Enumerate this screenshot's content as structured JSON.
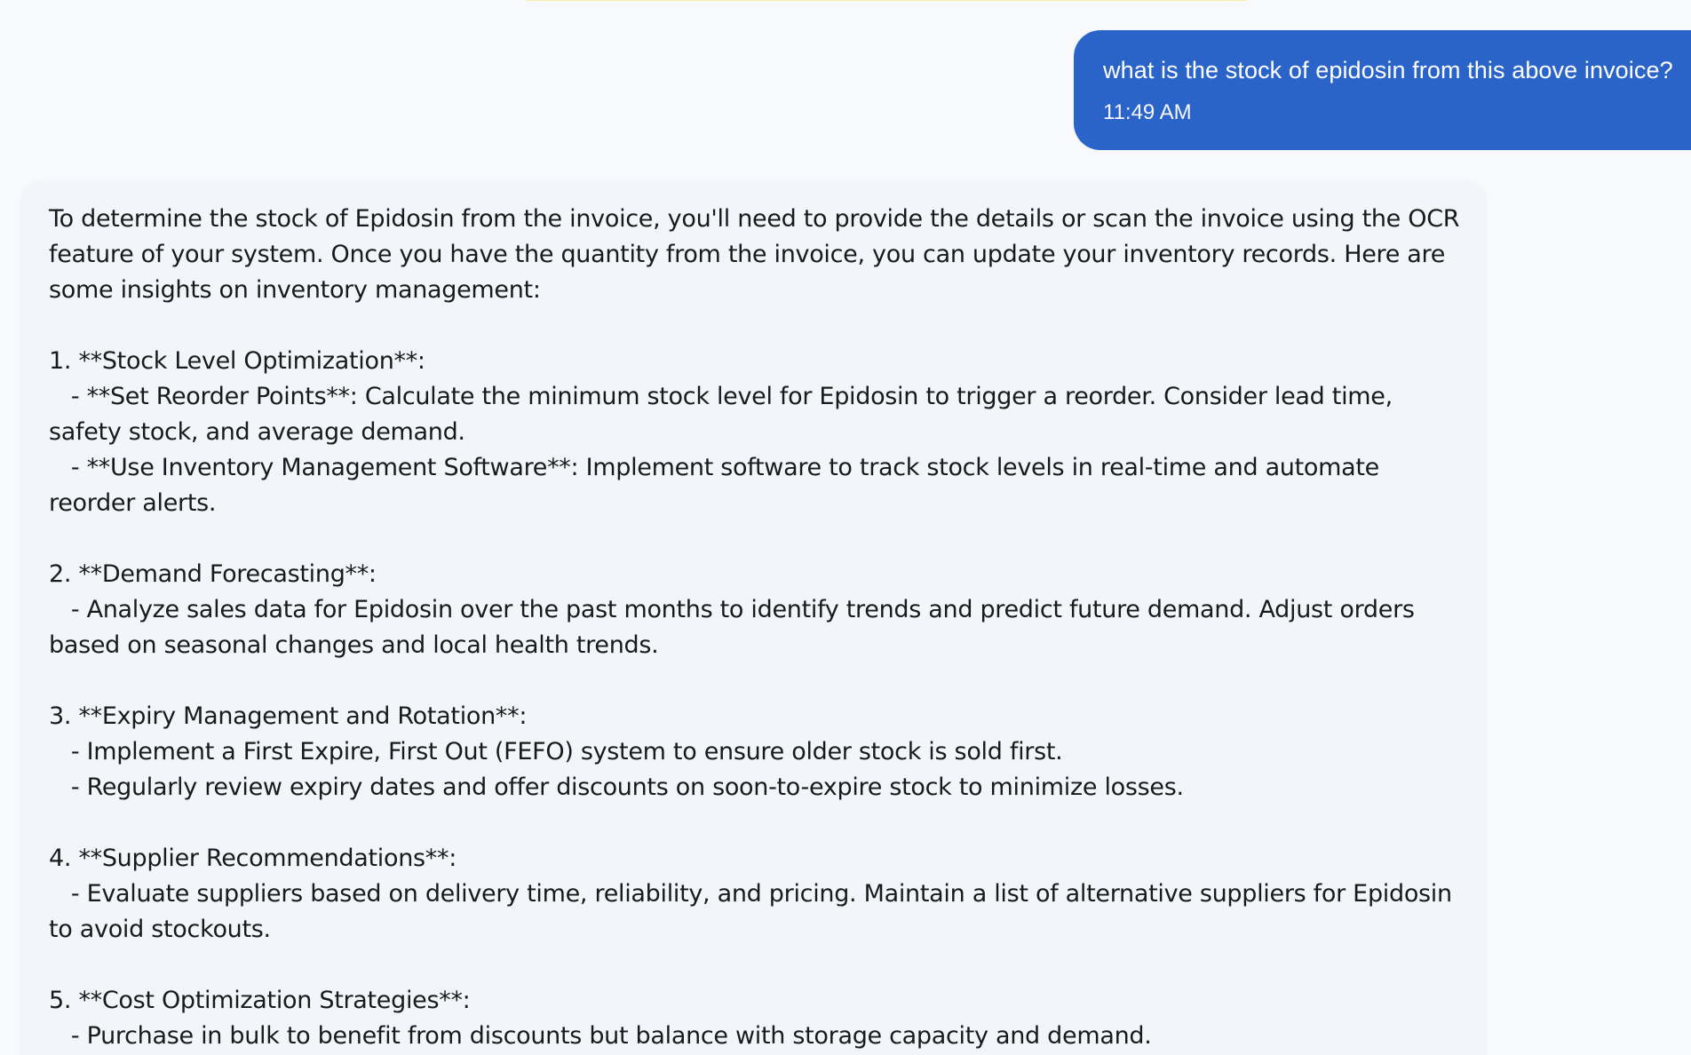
{
  "user_message": {
    "text": "what is the stock of epidosin from this above invoice?",
    "time": "11:49 AM"
  },
  "assistant_message": {
    "lines": [
      "To determine the stock of Epidosin from the invoice, you'll need to provide the details or scan the invoice using the OCR",
      "feature of your system. Once you have the quantity from the invoice, you can update your inventory records. Here are",
      "some insights on inventory management:",
      "",
      "1. **Stock Level Optimization**:",
      "   - **Set Reorder Points**: Calculate the minimum stock level for Epidosin to trigger a reorder. Consider lead time,",
      "safety stock, and average demand.",
      "   - **Use Inventory Management Software**: Implement software to track stock levels in real-time and automate",
      "reorder alerts.",
      "",
      "2. **Demand Forecasting**:",
      "   - Analyze sales data for Epidosin over the past months to identify trends and predict future demand. Adjust orders",
      "based on seasonal changes and local health trends.",
      "",
      "3. **Expiry Management and Rotation**:",
      "   - Implement a First Expire, First Out (FEFO) system to ensure older stock is sold first.",
      "   - Regularly review expiry dates and offer discounts on soon-to-expire stock to minimize losses.",
      "",
      "4. **Supplier Recommendations**:",
      "   - Evaluate suppliers based on delivery time, reliability, and pricing. Maintain a list of alternative suppliers for Epidosin",
      "to avoid stockouts.",
      "",
      "5. **Cost Optimization Strategies**:",
      "   - Purchase in bulk to benefit from discounts but balance with storage capacity and demand."
    ]
  },
  "colors": {
    "page_background": "#f8f9fc",
    "user_bubble": "#2b64c9",
    "assistant_bubble": "#f2f5fa",
    "top_accent": "#fdeeb0"
  }
}
